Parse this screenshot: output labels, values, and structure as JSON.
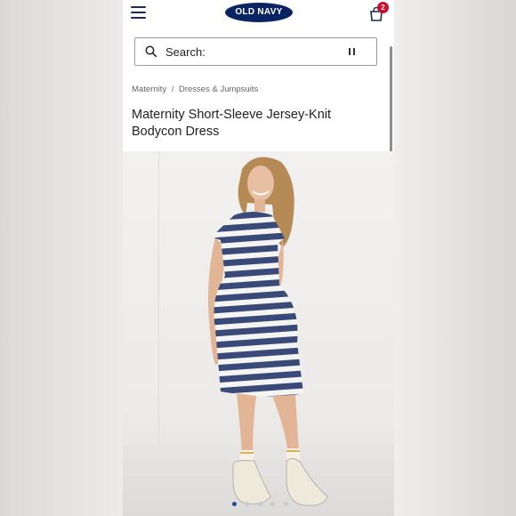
{
  "header": {
    "logo_text": "OLD NAVY",
    "bag_count": "2",
    "brand_color": "#0a2463",
    "badge_color": "#c8102e"
  },
  "search": {
    "label": "Search:"
  },
  "breadcrumb": {
    "items": [
      "Maternity",
      "Dresses & Jumpsuits"
    ],
    "separator": "/"
  },
  "product": {
    "title": "Maternity Short-Sleeve Jersey-Knit Bodycon Dress"
  },
  "carousel": {
    "total_images": 5,
    "active_index": 0
  }
}
